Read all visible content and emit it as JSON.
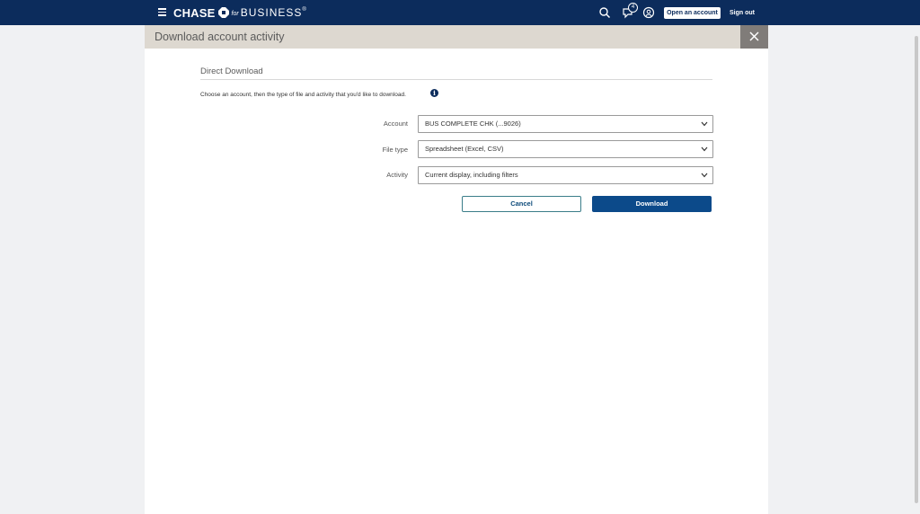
{
  "header": {
    "brand_name": "CHASE",
    "brand_for": "for",
    "brand_business": "BUSINESS",
    "brand_tm": "®",
    "notification_count": "4",
    "open_account_label": "Open an account",
    "sign_out_label": "Sign out",
    "icons": [
      "menu-icon",
      "search-icon",
      "notifications-icon",
      "profile-icon"
    ]
  },
  "modal": {
    "title": "Download account activity",
    "close_icon": "close-icon",
    "section_title": "Direct Download",
    "instructions": "Choose an account, then the type of file and activity that you'd like to download.",
    "info_icon_glyph": "i",
    "fields": [
      {
        "label": "Account",
        "value": "BUS COMPLETE CHK (...9026)"
      },
      {
        "label": "File type",
        "value": "Spreadsheet (Excel, CSV)"
      },
      {
        "label": "Activity",
        "value": "Current display, including filters"
      }
    ],
    "cancel_label": "Cancel",
    "download_label": "Download"
  },
  "colors": {
    "nav_bg": "#0c2c5c",
    "header_bg": "#ddd8d0",
    "close_bg": "#807c79",
    "primary_button": "#0c4a8a"
  }
}
